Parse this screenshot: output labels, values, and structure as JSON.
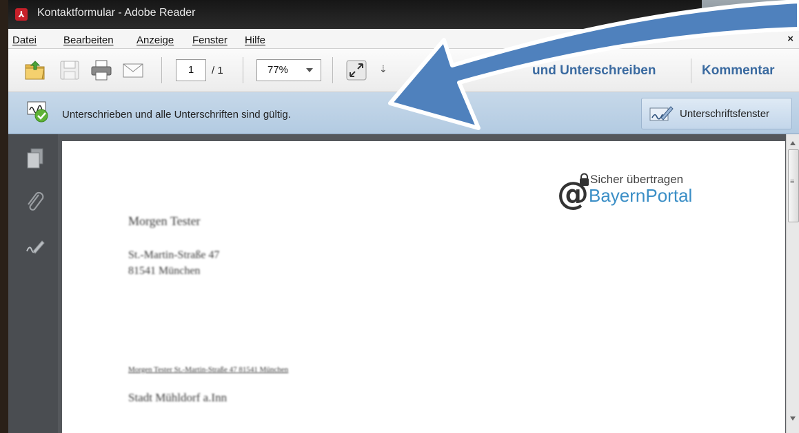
{
  "window": {
    "title": "Kontaktformular - Adobe Reader",
    "app_icon_glyph": "⅄"
  },
  "menu": {
    "items": [
      "Datei",
      "Bearbeiten",
      "Anzeige",
      "Fenster",
      "Hilfe"
    ],
    "close_glyph": "×"
  },
  "toolbar": {
    "page_current": "1",
    "page_total": "/ 1",
    "zoom": "77%",
    "more_glyph": "⇣",
    "sign_label": "und Unterschreiben",
    "comment_label": "Kommentar",
    "icons": [
      "open-icon",
      "save-icon",
      "print-icon",
      "email-icon",
      "fit-width-icon"
    ]
  },
  "signature_bar": {
    "status": "Unterschrieben und alle Unterschriften sind gültig.",
    "panel_button": "Unterschriftsfenster"
  },
  "left_panel": {
    "icons": [
      "pages-icon",
      "attachment-icon",
      "signature-icon"
    ]
  },
  "document": {
    "logo_sub": "Sicher übertragen",
    "logo_name": "BayernPortal",
    "sender_name": "Morgen Tester",
    "sender_street": "St.-Martin-Straße 47",
    "sender_city": "81541 München",
    "return_line": "Morgen Tester St.-Martin-Straße 47 81541 München",
    "recipient": "Stadt Mühldorf a.Inn"
  },
  "colors": {
    "accent_blue": "#3a6aa0",
    "arrow_fill": "#4f81bd",
    "signature_bar": "#b3cbe2"
  }
}
